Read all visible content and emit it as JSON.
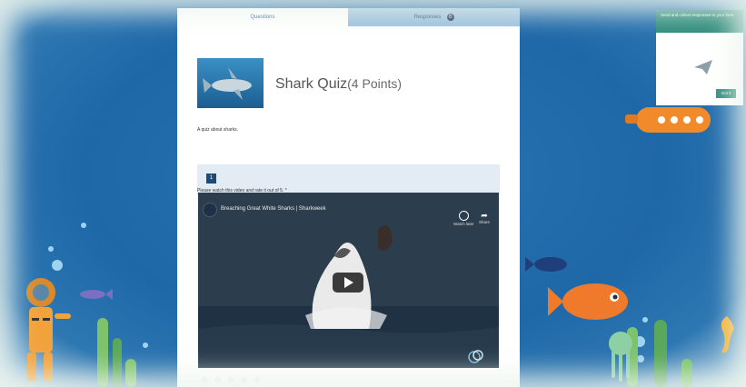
{
  "tabs": [
    {
      "label": "Questions"
    },
    {
      "label": "Responses",
      "badge": "0"
    }
  ],
  "form": {
    "title": "Shark Quiz",
    "points": "(4 Points)",
    "description": "A quiz about sharks.",
    "question": {
      "number": "1",
      "text": "Please watch this video and rate it out of 5. *"
    }
  },
  "video": {
    "title": "Breaching Great White Sharks | Sharkweek",
    "watch_later": "Watch later",
    "share": "Share"
  },
  "rating": {
    "stars": "☆ ☆ ☆ ☆ ☆",
    "max": 5
  },
  "popup": {
    "text": "Send and collect responses to your form.",
    "button": "Got it"
  },
  "colors": {
    "ocean": "#1f68a8",
    "tab_active": "#ffffff",
    "tab_inactive": "#9bc0de",
    "popup_green": "#2f8c7c",
    "question_band": "#e3ecf5"
  }
}
